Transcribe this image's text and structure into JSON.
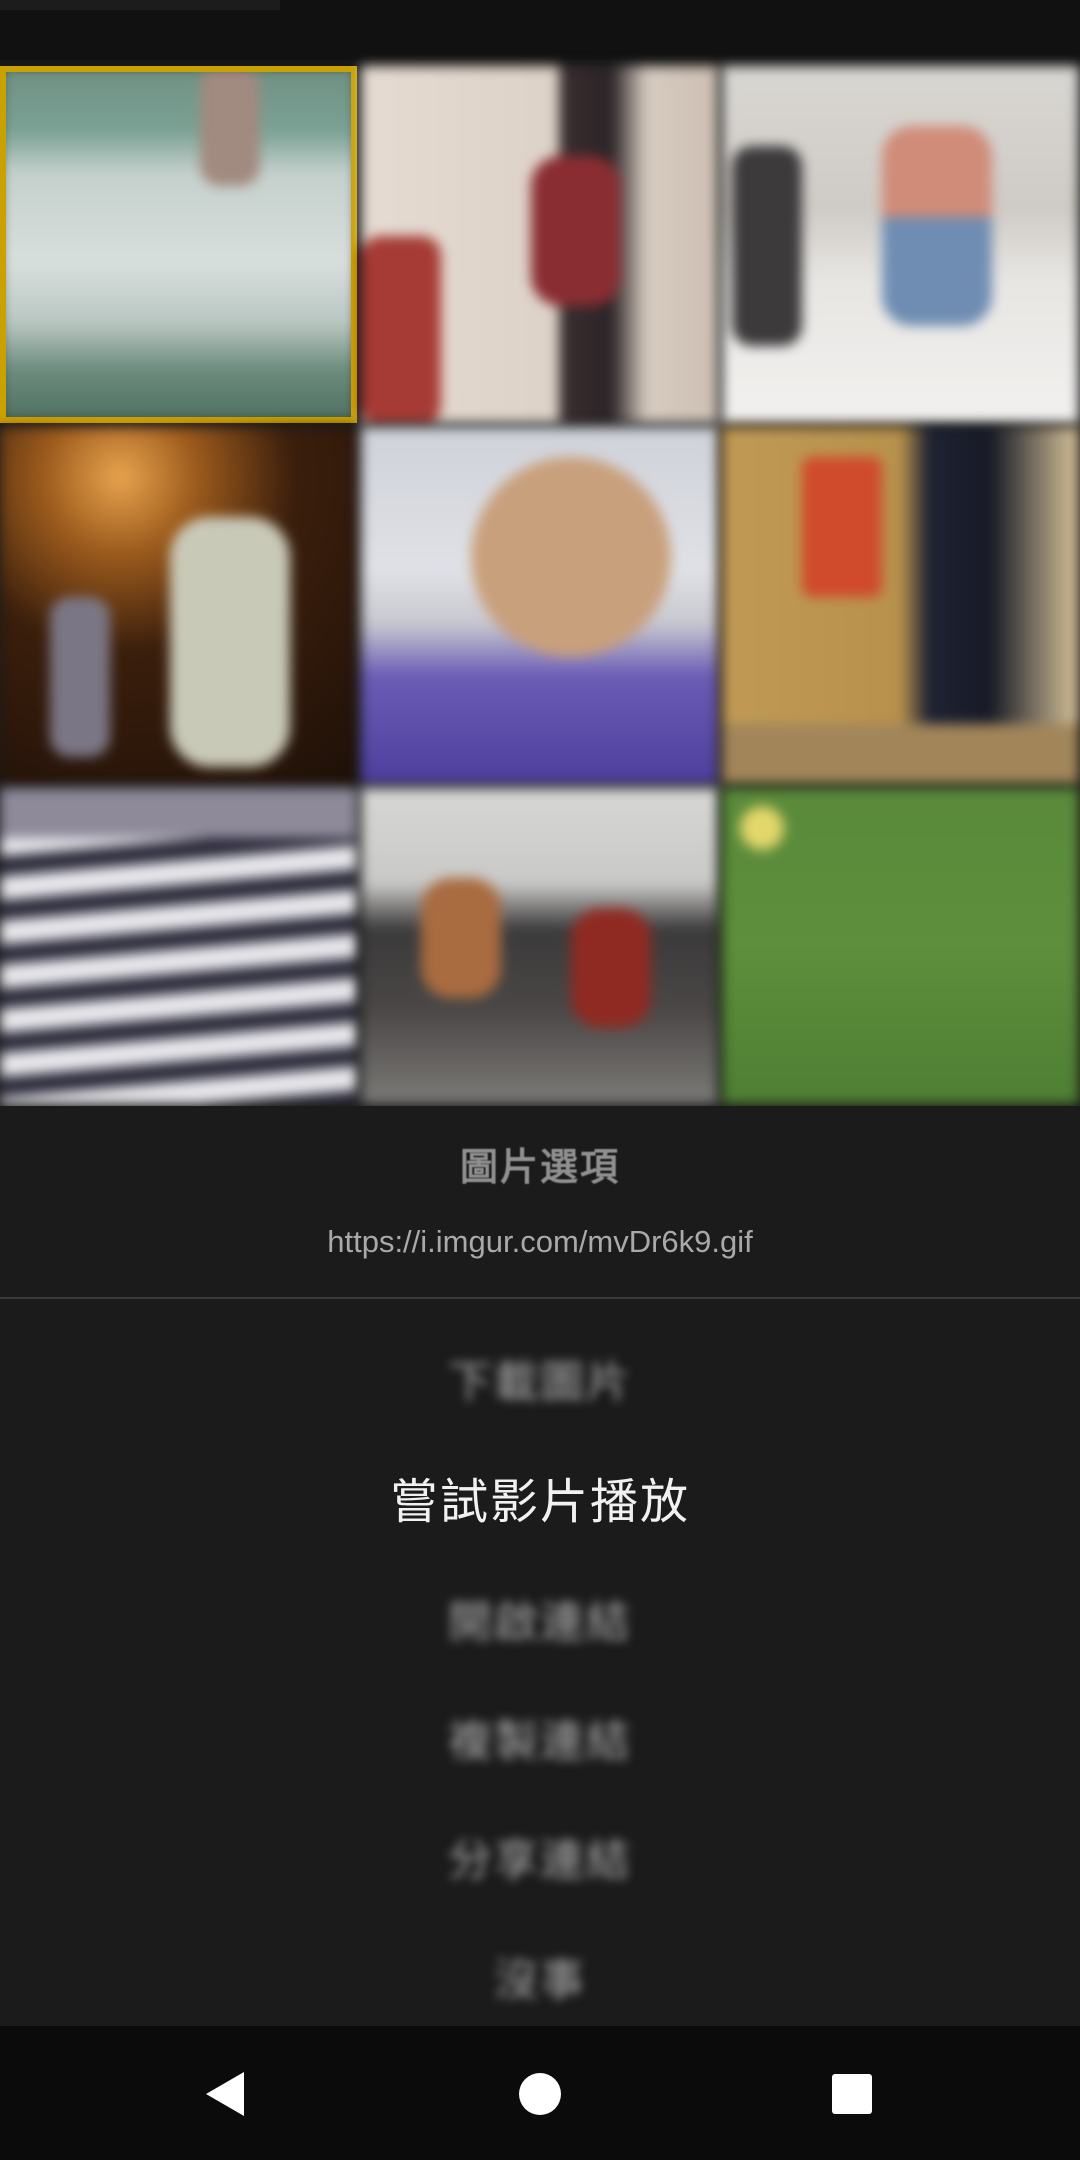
{
  "thumbnails": [
    {
      "id": "t1",
      "selected": true
    },
    {
      "id": "t2",
      "selected": false
    },
    {
      "id": "t3",
      "selected": false
    },
    {
      "id": "t4",
      "selected": false
    },
    {
      "id": "t5",
      "selected": false
    },
    {
      "id": "t6",
      "selected": false
    },
    {
      "id": "t7",
      "selected": false
    },
    {
      "id": "t8",
      "selected": false
    },
    {
      "id": "t9",
      "selected": false
    }
  ],
  "dialog": {
    "title": "圖片選項",
    "url": "https://i.imgur.com/mvDr6k9.gif",
    "items": [
      {
        "label": "下載圖片"
      },
      {
        "label": "嘗試影片播放"
      },
      {
        "label": "開啟連結"
      },
      {
        "label": "複製連結"
      },
      {
        "label": "分享連結"
      },
      {
        "label": "沒事"
      }
    ]
  },
  "navigation": {
    "back_icon": "back-icon",
    "home_icon": "home-icon",
    "recents_icon": "recents-icon"
  },
  "colors": {
    "selection_border": "#c9a100",
    "background": "#161616",
    "menu_text": "#aaaaaa",
    "menu_text_active": "#f1f1f1"
  }
}
